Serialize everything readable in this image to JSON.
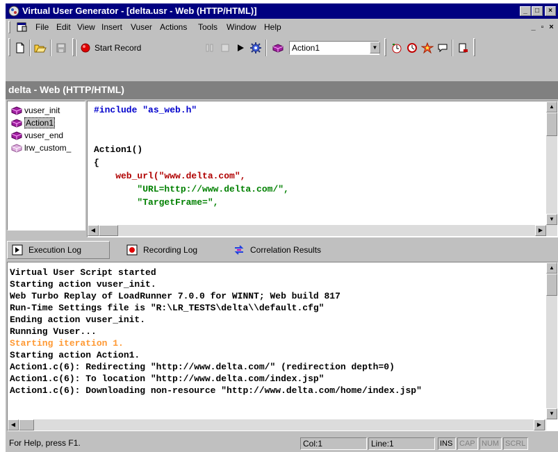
{
  "window": {
    "title": "Virtual User Generator - [delta.usr - Web (HTTP/HTML)]"
  },
  "menu": [
    "File",
    "Edit",
    "View",
    "Insert",
    "Vuser",
    "Actions",
    "Tools",
    "Window",
    "Help"
  ],
  "toolbar": {
    "start_record_label": "Start Record",
    "action_select_value": "Action1"
  },
  "script_header": "delta - Web (HTTP/HTML)",
  "actions_tree": [
    {
      "label": "vuser_init"
    },
    {
      "label": "Action1",
      "selected": true
    },
    {
      "label": "vuser_end"
    },
    {
      "label": "lrw_custom_"
    }
  ],
  "editor": {
    "lines": [
      "#include \"as_web.h\"",
      "",
      "",
      "Action1()",
      "{",
      "    web_url(\"www.delta.com\",",
      "        \"URL=http://www.delta.com/\",",
      "        \"TargetFrame=\","
    ]
  },
  "tabs": [
    {
      "label": "Execution Log",
      "active": true
    },
    {
      "label": "Recording Log"
    },
    {
      "label": "Correlation Results"
    }
  ],
  "log": {
    "lines": [
      "Virtual User Script started",
      "Starting action vuser_init.",
      "Web Turbo Replay of LoadRunner 7.0.0 for WINNT; Web build 817",
      "Run-Time Settings file is \"R:\\LR_TESTS\\delta\\\\default.cfg\"",
      "Ending action vuser_init.",
      "Running Vuser...",
      "Starting iteration 1.",
      "Starting action Action1.",
      "Action1.c(6): Redirecting \"http://www.delta.com/\" (redirection depth=0)",
      "Action1.c(6): To location \"http://www.delta.com/index.jsp\"",
      "Action1.c(6): Downloading non-resource \"http://www.delta.com/home/index.jsp\""
    ]
  },
  "status": {
    "help": "For Help, press F1.",
    "col": "Col:1",
    "line": "Line:1",
    "indicators": [
      "INS",
      "CAP",
      "NUM",
      "SCRL"
    ]
  },
  "colors": {
    "titlebar": "#000080",
    "keyword": "#0000cc",
    "function": "#b00000",
    "string": "#008000",
    "log_highlight": "#ff9933",
    "chrome": "#c0c0c0"
  }
}
